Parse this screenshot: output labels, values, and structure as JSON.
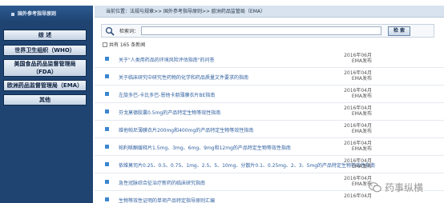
{
  "sidebar": {
    "title": "国外参考指导原则",
    "items": [
      {
        "label": "综    述"
      },
      {
        "label": "世界卫生组织（WHO）"
      },
      {
        "label": "美国食品药品监督管理局（FDA）"
      },
      {
        "label": "欧洲药品监督管理局（EMA）"
      },
      {
        "label": "其他"
      }
    ]
  },
  "breadcrumb": "当前位置：法规与规章>> 国外参考指导原则>> 欧洲药品监管局（EMA）",
  "search": {
    "label": "检索词：",
    "value": "",
    "button": "检  索"
  },
  "count_text": "共有 165 条新闻",
  "articles": [
    {
      "title": "关于\"人类用药品的环境风险评估指南\"的问答",
      "date": "2016年06月",
      "source": "EMA发布"
    },
    {
      "title": "关于临床研究中研究性药物的化学和药品质量文件要求的指南",
      "date": "2016年04月",
      "source": "EMA发布"
    },
    {
      "title": "左旋多巴-卡比多巴-恩他卡朋薄膜衣片BE指南",
      "date": "2016年04月",
      "source": "EMA发布"
    },
    {
      "title": "芬戈莫德胶囊0.5mg的产品特定生物等效性指南",
      "date": "2016年04月",
      "source": "EMA发布"
    },
    {
      "title": "维他帕尼薄膜衣片200mg和400mg的产品特定生物等效性指南",
      "date": "2016年04月",
      "source": "EMA发布"
    },
    {
      "title": "帕利哌酮缓释片1.5mg、3mg、6mg、9mg和12mg的产品特定生物等效性指南",
      "date": "2016年04月",
      "source": "EMA发布"
    },
    {
      "title": "依维莫司片0.25、0.5、0.75、1mg、2.5、5、10mg、分散片0.1、0.25mg、2、3、5mg的产品特定生物等效性指南",
      "date": "2016年04月",
      "source": "EMA发布"
    },
    {
      "title": "急性冠脉综合征治疗新药的临床研究指南",
      "date": "2016年04月",
      "source": "EMA发布"
    },
    {
      "title": "生物等效性证明的单项产品特定指导原则汇编",
      "date": "2016年04月",
      "source": ""
    }
  ],
  "watermark": "药事纵横"
}
